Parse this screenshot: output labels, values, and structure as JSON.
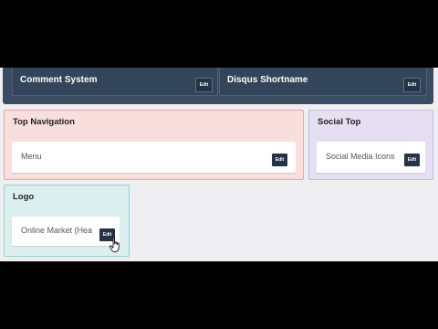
{
  "header": {
    "widgets": [
      {
        "title": "Comment System",
        "edit_label": "Edit"
      },
      {
        "title": "Disqus Shortname",
        "edit_label": "Edit"
      }
    ]
  },
  "areas": [
    {
      "title": "Top Navigation",
      "widget_label": "Menu",
      "edit_label": "Edit",
      "color": "#f8dedd"
    },
    {
      "title": "Social Top",
      "widget_label": "Social Media Icons",
      "edit_label": "Edit",
      "color": "#e5e0f1"
    },
    {
      "title": "Logo",
      "widget_label": "Online Market (Hea",
      "edit_label": "Edit",
      "color": "#dcefef"
    }
  ],
  "colors": {
    "header_band": "#3a4c61",
    "edit_button": "#243446",
    "top_navigation_border": "#e5a7a5",
    "social_top_border": "#c6b9e4",
    "logo_border": "#98cfcf"
  },
  "icons": {
    "cursor": "hand-pointer-icon"
  }
}
